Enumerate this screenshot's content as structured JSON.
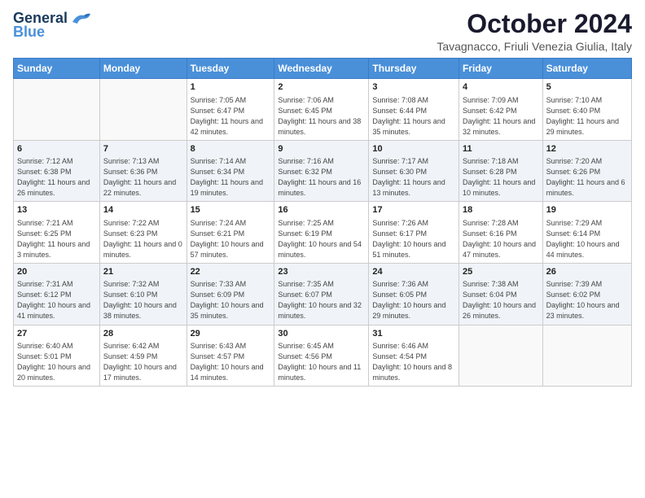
{
  "logo": {
    "line1": "General",
    "line2": "Blue"
  },
  "title": "October 2024",
  "subtitle": "Tavagnacco, Friuli Venezia Giulia, Italy",
  "headers": [
    "Sunday",
    "Monday",
    "Tuesday",
    "Wednesday",
    "Thursday",
    "Friday",
    "Saturday"
  ],
  "weeks": [
    [
      {
        "day": "",
        "info": ""
      },
      {
        "day": "",
        "info": ""
      },
      {
        "day": "1",
        "info": "Sunrise: 7:05 AM\nSunset: 6:47 PM\nDaylight: 11 hours and 42 minutes."
      },
      {
        "day": "2",
        "info": "Sunrise: 7:06 AM\nSunset: 6:45 PM\nDaylight: 11 hours and 38 minutes."
      },
      {
        "day": "3",
        "info": "Sunrise: 7:08 AM\nSunset: 6:44 PM\nDaylight: 11 hours and 35 minutes."
      },
      {
        "day": "4",
        "info": "Sunrise: 7:09 AM\nSunset: 6:42 PM\nDaylight: 11 hours and 32 minutes."
      },
      {
        "day": "5",
        "info": "Sunrise: 7:10 AM\nSunset: 6:40 PM\nDaylight: 11 hours and 29 minutes."
      }
    ],
    [
      {
        "day": "6",
        "info": "Sunrise: 7:12 AM\nSunset: 6:38 PM\nDaylight: 11 hours and 26 minutes."
      },
      {
        "day": "7",
        "info": "Sunrise: 7:13 AM\nSunset: 6:36 PM\nDaylight: 11 hours and 22 minutes."
      },
      {
        "day": "8",
        "info": "Sunrise: 7:14 AM\nSunset: 6:34 PM\nDaylight: 11 hours and 19 minutes."
      },
      {
        "day": "9",
        "info": "Sunrise: 7:16 AM\nSunset: 6:32 PM\nDaylight: 11 hours and 16 minutes."
      },
      {
        "day": "10",
        "info": "Sunrise: 7:17 AM\nSunset: 6:30 PM\nDaylight: 11 hours and 13 minutes."
      },
      {
        "day": "11",
        "info": "Sunrise: 7:18 AM\nSunset: 6:28 PM\nDaylight: 11 hours and 10 minutes."
      },
      {
        "day": "12",
        "info": "Sunrise: 7:20 AM\nSunset: 6:26 PM\nDaylight: 11 hours and 6 minutes."
      }
    ],
    [
      {
        "day": "13",
        "info": "Sunrise: 7:21 AM\nSunset: 6:25 PM\nDaylight: 11 hours and 3 minutes."
      },
      {
        "day": "14",
        "info": "Sunrise: 7:22 AM\nSunset: 6:23 PM\nDaylight: 11 hours and 0 minutes."
      },
      {
        "day": "15",
        "info": "Sunrise: 7:24 AM\nSunset: 6:21 PM\nDaylight: 10 hours and 57 minutes."
      },
      {
        "day": "16",
        "info": "Sunrise: 7:25 AM\nSunset: 6:19 PM\nDaylight: 10 hours and 54 minutes."
      },
      {
        "day": "17",
        "info": "Sunrise: 7:26 AM\nSunset: 6:17 PM\nDaylight: 10 hours and 51 minutes."
      },
      {
        "day": "18",
        "info": "Sunrise: 7:28 AM\nSunset: 6:16 PM\nDaylight: 10 hours and 47 minutes."
      },
      {
        "day": "19",
        "info": "Sunrise: 7:29 AM\nSunset: 6:14 PM\nDaylight: 10 hours and 44 minutes."
      }
    ],
    [
      {
        "day": "20",
        "info": "Sunrise: 7:31 AM\nSunset: 6:12 PM\nDaylight: 10 hours and 41 minutes."
      },
      {
        "day": "21",
        "info": "Sunrise: 7:32 AM\nSunset: 6:10 PM\nDaylight: 10 hours and 38 minutes."
      },
      {
        "day": "22",
        "info": "Sunrise: 7:33 AM\nSunset: 6:09 PM\nDaylight: 10 hours and 35 minutes."
      },
      {
        "day": "23",
        "info": "Sunrise: 7:35 AM\nSunset: 6:07 PM\nDaylight: 10 hours and 32 minutes."
      },
      {
        "day": "24",
        "info": "Sunrise: 7:36 AM\nSunset: 6:05 PM\nDaylight: 10 hours and 29 minutes."
      },
      {
        "day": "25",
        "info": "Sunrise: 7:38 AM\nSunset: 6:04 PM\nDaylight: 10 hours and 26 minutes."
      },
      {
        "day": "26",
        "info": "Sunrise: 7:39 AM\nSunset: 6:02 PM\nDaylight: 10 hours and 23 minutes."
      }
    ],
    [
      {
        "day": "27",
        "info": "Sunrise: 6:40 AM\nSunset: 5:01 PM\nDaylight: 10 hours and 20 minutes."
      },
      {
        "day": "28",
        "info": "Sunrise: 6:42 AM\nSunset: 4:59 PM\nDaylight: 10 hours and 17 minutes."
      },
      {
        "day": "29",
        "info": "Sunrise: 6:43 AM\nSunset: 4:57 PM\nDaylight: 10 hours and 14 minutes."
      },
      {
        "day": "30",
        "info": "Sunrise: 6:45 AM\nSunset: 4:56 PM\nDaylight: 10 hours and 11 minutes."
      },
      {
        "day": "31",
        "info": "Sunrise: 6:46 AM\nSunset: 4:54 PM\nDaylight: 10 hours and 8 minutes."
      },
      {
        "day": "",
        "info": ""
      },
      {
        "day": "",
        "info": ""
      }
    ]
  ]
}
